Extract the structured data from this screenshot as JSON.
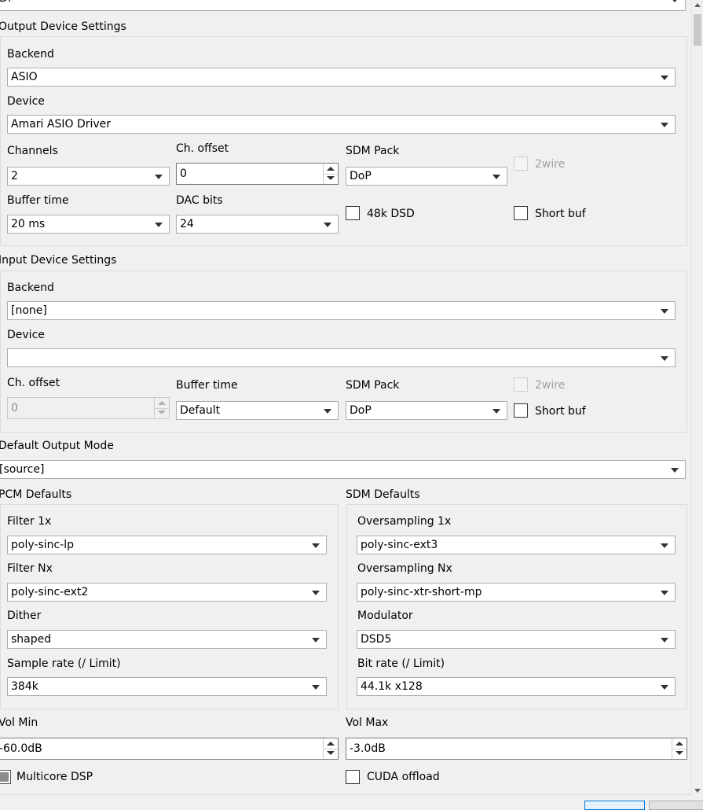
{
  "top_combo": {
    "value": "D:"
  },
  "output": {
    "title": "Output Device Settings",
    "backend_label": "Backend",
    "backend_value": "ASIO",
    "device_label": "Device",
    "device_value": "Amari ASIO Driver",
    "channels_label": "Channels",
    "channels_value": "2",
    "ch_offset_label": "Ch. offset",
    "ch_offset_value": "0",
    "sdm_pack_label": "SDM Pack",
    "sdm_pack_value": "DoP",
    "twowire_label": "2wire",
    "buffer_time_label": "Buffer time",
    "buffer_time_value": "20 ms",
    "dac_bits_label": "DAC bits",
    "dac_bits_value": "24",
    "dsd48k_label": "48k DSD",
    "short_buf_label": "Short buf"
  },
  "input": {
    "title": "Input Device Settings",
    "backend_label": "Backend",
    "backend_value": "[none]",
    "device_label": "Device",
    "device_value": "",
    "ch_offset_label": "Ch. offset",
    "ch_offset_value": "0",
    "buffer_time_label": "Buffer time",
    "buffer_time_value": "Default",
    "sdm_pack_label": "SDM Pack",
    "sdm_pack_value": "DoP",
    "twowire_label": "2wire",
    "short_buf_label": "Short buf"
  },
  "default_output_mode": {
    "label": "Default Output Mode",
    "value": "[source]"
  },
  "pcm": {
    "title": "PCM Defaults",
    "filter1x_label": "Filter 1x",
    "filter1x_value": "poly-sinc-lp",
    "filterNx_label": "Filter Nx",
    "filterNx_value": "poly-sinc-ext2",
    "dither_label": "Dither",
    "dither_value": "shaped",
    "rate_label": "Sample rate (/ Limit)",
    "rate_value": "384k"
  },
  "sdm": {
    "title": "SDM Defaults",
    "os1x_label": "Oversampling 1x",
    "os1x_value": "poly-sinc-ext3",
    "osNx_label": "Oversampling Nx",
    "osNx_value": "poly-sinc-xtr-short-mp",
    "modulator_label": "Modulator",
    "modulator_value": "DSD5",
    "bitrate_label": "Bit rate (/ Limit)",
    "bitrate_value": "44.1k x128"
  },
  "vol": {
    "min_label": "Vol Min",
    "min_value": "-60.0dB",
    "max_label": "Vol Max",
    "max_value": "-3.0dB"
  },
  "options": {
    "multicore_label": "Multicore DSP",
    "cuda_label": "CUDA offload"
  }
}
